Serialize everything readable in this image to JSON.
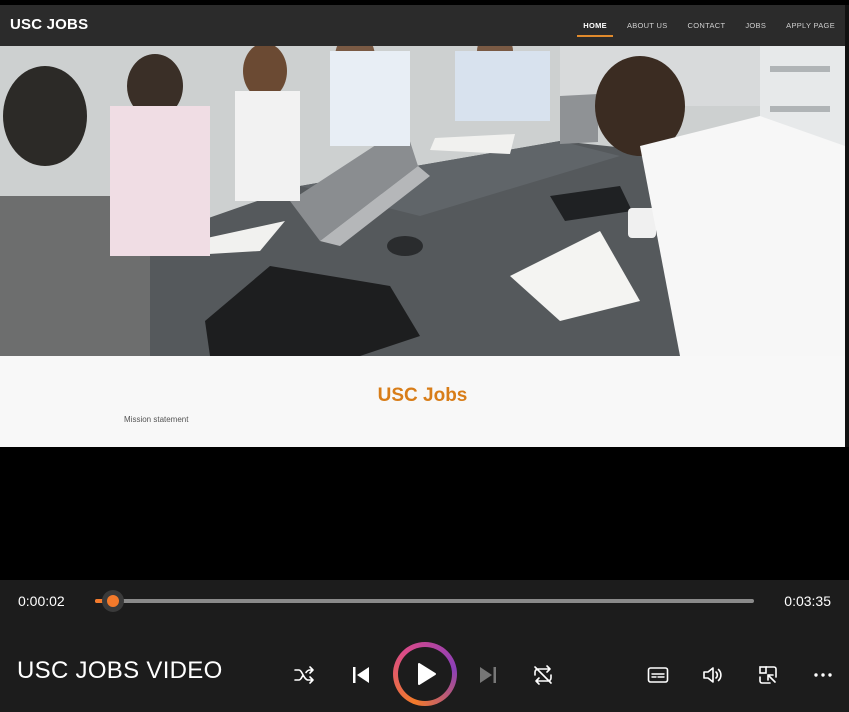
{
  "site": {
    "brand": "USC JOBS",
    "nav": [
      {
        "label": "HOME",
        "active": true
      },
      {
        "label": "ABOUT US",
        "active": false
      },
      {
        "label": "CONTACT",
        "active": false
      },
      {
        "label": "JOBS",
        "active": false
      },
      {
        "label": "APPLY PAGE",
        "active": false
      }
    ],
    "title": "USC Jobs",
    "mission": "Mission statement",
    "accent_color": "#d87d18"
  },
  "player": {
    "current_time": "0:00:02",
    "total_time": "0:03:35",
    "progress": 0.009,
    "video_title": "USC JOBS VIDEO",
    "accent_color": "#f47a2b",
    "icons": [
      "shuffle-icon",
      "previous-icon",
      "play-icon",
      "next-icon",
      "repeat-icon",
      "captions-icon",
      "volume-icon",
      "mini-player-icon",
      "more-icon"
    ]
  }
}
